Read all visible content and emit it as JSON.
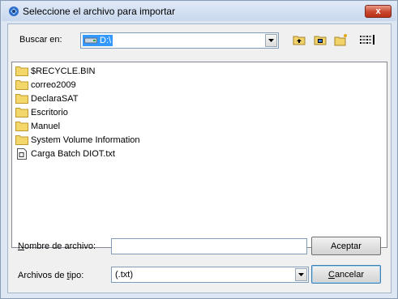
{
  "window": {
    "title": "Seleccione el archivo para importar",
    "close_label": "x"
  },
  "toolbar": {
    "look_in_label": "Buscar en:",
    "look_in_value": "D:\\",
    "icons": [
      "up-folder-icon",
      "desktop-icon",
      "new-folder-icon",
      "list-view-icon"
    ]
  },
  "files": [
    {
      "name": "$RECYCLE.BIN",
      "type": "folder"
    },
    {
      "name": "correo2009",
      "type": "folder"
    },
    {
      "name": "DeclaraSAT",
      "type": "folder"
    },
    {
      "name": "Escritorio",
      "type": "folder"
    },
    {
      "name": "Manuel",
      "type": "folder"
    },
    {
      "name": "System Volume Information",
      "type": "folder"
    },
    {
      "name": "Carga Batch DIOT.txt",
      "type": "file"
    }
  ],
  "filename": {
    "label_prefix": "N",
    "label_rest": "ombre de archivo:",
    "value": ""
  },
  "filetype": {
    "label_prefix": "Archivos de ",
    "label_underlined": "t",
    "label_rest": "ipo:",
    "value": "(.txt)"
  },
  "buttons": {
    "accept": "Aceptar",
    "cancel_prefix": "C",
    "cancel_rest": "ancelar"
  }
}
